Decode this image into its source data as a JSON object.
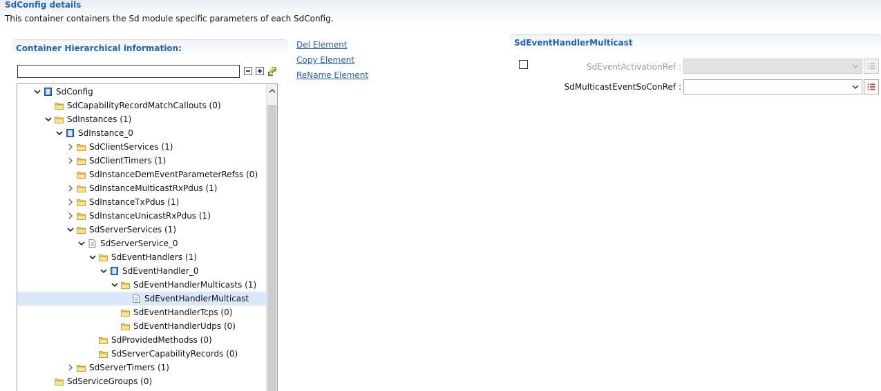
{
  "page": {
    "title": "SdConfig details",
    "description": "This container containers the Sd module specific parameters of each SdConfig."
  },
  "hierarchy": {
    "title": "Container Hierarchical information:",
    "filter_value": "",
    "toolbar": {
      "collapse_icon": "collapse-all-icon",
      "expand_icon": "expand-all-icon",
      "link_icon": "link-with-editor-icon"
    }
  },
  "tree": [
    {
      "label": "SdConfig",
      "icon": "module-config-icon",
      "indent": 0,
      "twisty": "expanded"
    },
    {
      "label": "SdCapabilityRecordMatchCallouts (0)",
      "icon": "folder-icon",
      "indent": 1,
      "twisty": "none"
    },
    {
      "label": "SdInstances (1)",
      "icon": "folder-icon",
      "indent": 1,
      "twisty": "expanded"
    },
    {
      "label": "SdInstance_0",
      "icon": "module-config-icon",
      "indent": 2,
      "twisty": "expanded"
    },
    {
      "label": "SdClientServices (1)",
      "icon": "folder-icon",
      "indent": 3,
      "twisty": "collapsed"
    },
    {
      "label": "SdClientTimers (1)",
      "icon": "folder-icon",
      "indent": 3,
      "twisty": "collapsed"
    },
    {
      "label": "SdInstanceDemEventParameterRefss (0)",
      "icon": "folder-icon",
      "indent": 3,
      "twisty": "none"
    },
    {
      "label": "SdInstanceMulticastRxPdus (1)",
      "icon": "folder-icon",
      "indent": 3,
      "twisty": "collapsed"
    },
    {
      "label": "SdInstanceTxPdus (1)",
      "icon": "folder-icon",
      "indent": 3,
      "twisty": "collapsed"
    },
    {
      "label": "SdInstanceUnicastRxPdus (1)",
      "icon": "folder-icon",
      "indent": 3,
      "twisty": "collapsed"
    },
    {
      "label": "SdServerServices (1)",
      "icon": "folder-icon",
      "indent": 3,
      "twisty": "expanded"
    },
    {
      "label": "SdServerService_0",
      "icon": "document-icon",
      "indent": 4,
      "twisty": "expanded"
    },
    {
      "label": "SdEventHandlers (1)",
      "icon": "folder-icon",
      "indent": 5,
      "twisty": "expanded"
    },
    {
      "label": "SdEventHandler_0",
      "icon": "module-config-icon",
      "indent": 6,
      "twisty": "expanded"
    },
    {
      "label": "SdEventHandlerMulticasts (1)",
      "icon": "folder-icon",
      "indent": 7,
      "twisty": "expanded"
    },
    {
      "label": "SdEventHandlerMulticast",
      "icon": "document-icon",
      "indent": 8,
      "twisty": "none",
      "selected": true
    },
    {
      "label": "SdEventHandlerTcps (0)",
      "icon": "folder-icon",
      "indent": 7,
      "twisty": "none"
    },
    {
      "label": "SdEventHandlerUdps (0)",
      "icon": "folder-icon",
      "indent": 7,
      "twisty": "none"
    },
    {
      "label": "SdProvidedMethodss (0)",
      "icon": "folder-icon",
      "indent": 5,
      "twisty": "none"
    },
    {
      "label": "SdServerCapabilityRecords (0)",
      "icon": "folder-icon",
      "indent": 5,
      "twisty": "none"
    },
    {
      "label": "SdServerTimers (1)",
      "icon": "folder-icon",
      "indent": 3,
      "twisty": "collapsed"
    },
    {
      "label": "SdServiceGroups (0)",
      "icon": "folder-icon",
      "indent": 1,
      "twisty": "none"
    }
  ],
  "actions": {
    "del": "Del Element",
    "copy": "Copy Element",
    "rename": "ReName Element"
  },
  "details": {
    "title": "SdEventHandlerMulticast",
    "activation_ref": {
      "label": "SdEventActivationRef :",
      "value": "",
      "enabled": false,
      "checked": false
    },
    "multicast_ref": {
      "label": "SdMulticastEventSoConRef :",
      "value": "",
      "enabled": true
    }
  },
  "colors": {
    "accent": "#1f63b5",
    "link": "#2a5fb0",
    "selection": "#d9e8fb",
    "folder": "#f4cf58",
    "module": "#3a7bd0",
    "list_button_enabled": "#d23b3b"
  }
}
